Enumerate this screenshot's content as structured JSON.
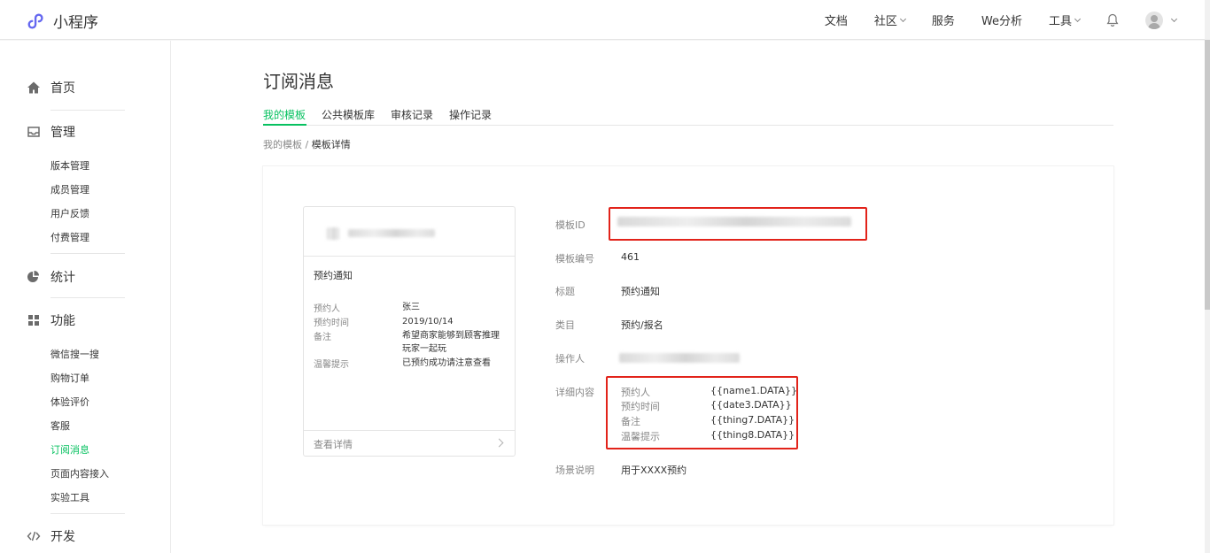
{
  "app": {
    "name": "小程序"
  },
  "topnav": {
    "items": [
      {
        "label": "文档",
        "has_caret": false
      },
      {
        "label": "社区",
        "has_caret": true
      },
      {
        "label": "服务",
        "has_caret": false
      },
      {
        "label": "We分析",
        "has_caret": false
      },
      {
        "label": "工具",
        "has_caret": true
      }
    ]
  },
  "sidebar": {
    "home": "首页",
    "manage": "管理",
    "manage_items": [
      "版本管理",
      "成员管理",
      "用户反馈",
      "付费管理"
    ],
    "stats": "统计",
    "features": "功能",
    "feature_items": [
      "微信搜一搜",
      "购物订单",
      "体验评价",
      "客服",
      "订阅消息",
      "页面内容接入",
      "实验工具"
    ],
    "active_item": "订阅消息",
    "develop": "开发"
  },
  "page": {
    "title": "订阅消息",
    "tabs": [
      "我的模板",
      "公共模板库",
      "审核记录",
      "操作记录"
    ],
    "active_tab": "我的模板",
    "breadcrumb": {
      "parent": "我的模板",
      "separator": "/",
      "current": "模板详情"
    }
  },
  "preview": {
    "title": "预约通知",
    "rows": [
      {
        "key": "预约人",
        "value": "张三"
      },
      {
        "key": "预约时间",
        "value": "2019/10/14"
      },
      {
        "key": "备注",
        "value": "希望商家能够到顾客推理玩家一起玩"
      },
      {
        "key": "温馨提示",
        "value": "已预约成功请注意查看"
      }
    ],
    "footer": "查看详情"
  },
  "info": {
    "template_id_label": "模板ID",
    "number_label": "模板编号",
    "number": "461",
    "title_label": "标题",
    "title": "预约通知",
    "category_label": "类目",
    "category": "预约/报名",
    "operator_label": "操作人",
    "content_label": "详细内容",
    "content": [
      {
        "key": "预约人",
        "value": "{{name1.DATA}}"
      },
      {
        "key": "预约时间",
        "value": "{{date3.DATA}}"
      },
      {
        "key": "备注",
        "value": "{{thing7.DATA}}"
      },
      {
        "key": "温馨提示",
        "value": "{{thing8.DATA}}"
      }
    ],
    "scene_label": "场景说明",
    "scene": "用于XXXX预约"
  },
  "colors": {
    "accent": "#07c160",
    "highlight": "#e2231a"
  }
}
